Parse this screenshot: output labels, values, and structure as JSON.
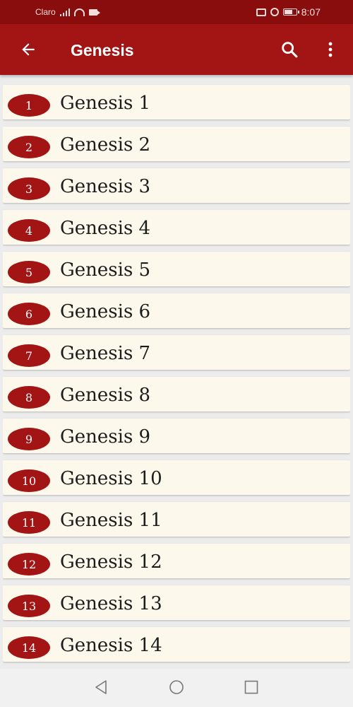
{
  "status_bar": {
    "carrier": "Claro",
    "time": "8:07",
    "icons": [
      "signal-icon",
      "wifi-icon",
      "video-icon",
      "cast-icon",
      "alarm-icon",
      "battery-icon"
    ]
  },
  "app_bar": {
    "title": "Genesis",
    "icons": [
      "back-arrow-icon",
      "search-icon",
      "more-vertical-icon"
    ]
  },
  "chapters": [
    {
      "number": "1",
      "label": "Genesis 1"
    },
    {
      "number": "2",
      "label": "Genesis 2"
    },
    {
      "number": "3",
      "label": "Genesis 3"
    },
    {
      "number": "4",
      "label": "Genesis 4"
    },
    {
      "number": "5",
      "label": "Genesis 5"
    },
    {
      "number": "6",
      "label": "Genesis 6"
    },
    {
      "number": "7",
      "label": "Genesis 7"
    },
    {
      "number": "8",
      "label": "Genesis 8"
    },
    {
      "number": "9",
      "label": "Genesis 9"
    },
    {
      "number": "10",
      "label": "Genesis 10"
    },
    {
      "number": "11",
      "label": "Genesis 11"
    },
    {
      "number": "12",
      "label": "Genesis 12"
    },
    {
      "number": "13",
      "label": "Genesis 13"
    },
    {
      "number": "14",
      "label": "Genesis 14"
    }
  ],
  "nav_bar": {
    "icons": [
      "nav-back-icon",
      "nav-home-icon",
      "nav-recents-icon"
    ]
  },
  "colors": {
    "status_bar": "#8a0d0d",
    "app_bar": "#a31414",
    "badge": "#a31414",
    "row_background": "#fcf9ec",
    "list_background": "#ececec"
  }
}
